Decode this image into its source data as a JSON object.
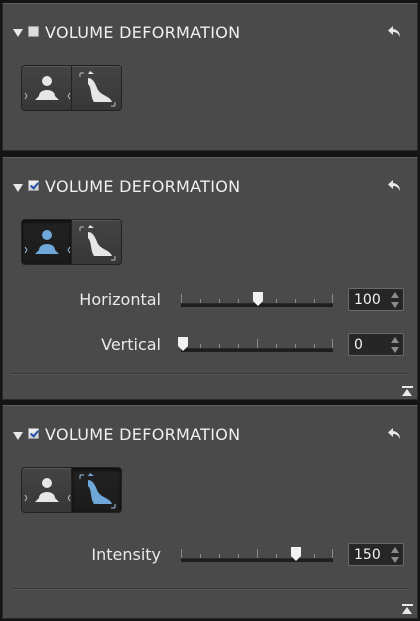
{
  "panels": [
    {
      "title": "VOLUME DEFORMATION",
      "checked": false,
      "active_mode": "none",
      "sliders": []
    },
    {
      "title": "VOLUME DEFORMATION",
      "checked": true,
      "active_mode": "horizontal-vertical",
      "sliders": [
        {
          "label": "Horizontal",
          "value": "100"
        },
        {
          "label": "Vertical",
          "value": "0"
        }
      ]
    },
    {
      "title": "VOLUME DEFORMATION",
      "checked": true,
      "active_mode": "intensity",
      "sliders": [
        {
          "label": "Intensity",
          "value": "150"
        }
      ]
    }
  ],
  "icons": {
    "collapse_arrow": "triangle-down-icon",
    "reset": "reset-arrow-icon",
    "mode_a": "horizontal-vertical-deformation-icon",
    "mode_b": "intensity-deformation-icon",
    "collapse_panel": "collapse-up-icon"
  },
  "colors": {
    "panel_bg": "#4a4a4a",
    "active_icon": "#6fa8d8",
    "inactive_icon": "#e6e6e6",
    "page_bg": "#141414"
  }
}
